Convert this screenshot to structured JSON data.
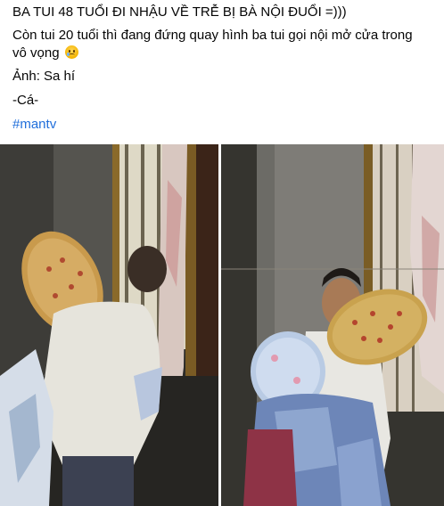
{
  "post": {
    "headline": "BA TUI 48 TUỔI ĐI NHẬU VỀ TRỄ BỊ BÀ NỘI ĐUỔI =)))",
    "line2": "Còn tui 20 tuổi thì đang đứng quay hình ba tui gọi nội mở cửa trong",
    "line3": "vô vọng",
    "emoji_icon": "crying-face-emoji",
    "photo_credit": "Ảnh: Sa hí",
    "signature": "-Cá-",
    "hashtag": "#mantv"
  },
  "colors": {
    "hashtag": "#216fdb",
    "text": "#050505",
    "background": "#ffffff"
  },
  "photos": [
    {
      "name": "photo-left",
      "subject": "man with pillows at gate (back view)"
    },
    {
      "name": "photo-right",
      "subject": "man carrying pillows and blanket (front view)"
    }
  ]
}
